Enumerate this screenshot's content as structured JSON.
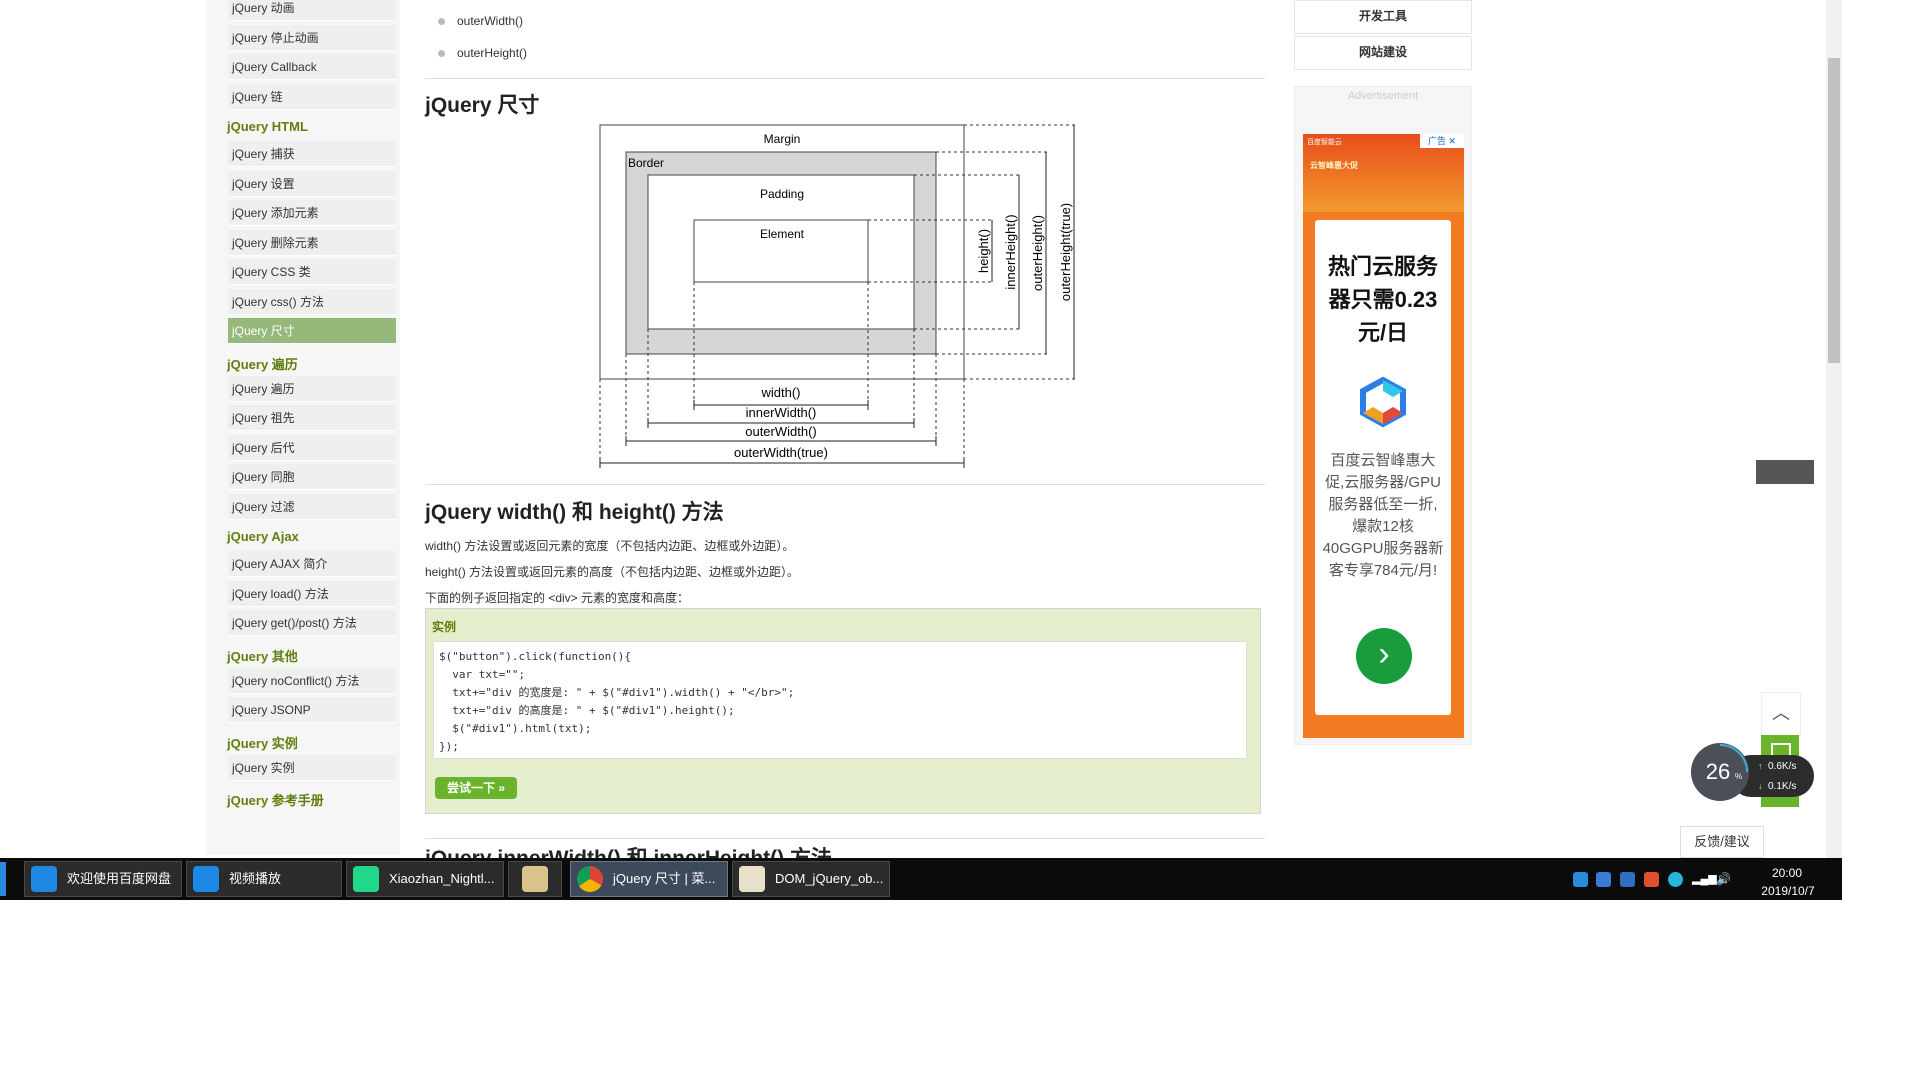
{
  "sidebar": {
    "items_top": [
      "jQuery 动画",
      "jQuery 停止动画",
      "jQuery Callback",
      "jQuery 链"
    ],
    "html_head": "jQuery HTML",
    "html_items": [
      "jQuery 捕获",
      "jQuery 设置",
      "jQuery 添加元素",
      "jQuery 删除元素",
      "jQuery CSS 类",
      "jQuery css() 方法",
      "jQuery 尺寸"
    ],
    "traverse_head": "jQuery 遍历",
    "traverse_items": [
      "jQuery 遍历",
      "jQuery 祖先",
      "jQuery 后代",
      "jQuery 同胞",
      "jQuery 过滤"
    ],
    "ajax_head": "jQuery Ajax",
    "ajax_items": [
      "jQuery AJAX 简介",
      "jQuery load() 方法",
      "jQuery get()/post() 方法"
    ],
    "other_head": "jQuery 其他",
    "other_items": [
      "jQuery noConflict() 方法",
      "jQuery JSONP"
    ],
    "example_head": "jQuery 实例",
    "example_items": [
      "jQuery 实例"
    ],
    "ref_head": "jQuery 参考手册"
  },
  "main": {
    "bullets": [
      "outerWidth()",
      "outerHeight()"
    ],
    "section1_title": "jQuery 尺寸",
    "diagram": {
      "margin": "Margin",
      "border": "Border",
      "padding": "Padding",
      "element": "Element",
      "width": "width()",
      "innerWidth": "innerWidth()",
      "outerWidth": "outerWidth()",
      "outerWidthTrue": "outerWidth(true)",
      "height": "height()",
      "innerHeight": "innerHeight()",
      "outerHeight": "outerHeight()",
      "outerHeightTrue": "outerHeight(true)"
    },
    "section2_title": "jQuery width() 和 height() 方法",
    "para1": "width() 方法设置或返回元素的宽度（不包括内边距、边框或外边距）。",
    "para2": "height() 方法设置或返回元素的高度（不包括内边距、边框或外边距）。",
    "para3": "下面的例子返回指定的 <div> 元素的宽度和高度：",
    "example_label": "实例",
    "code_lines": [
      "$(\"button\").click(function(){",
      "  var txt=\"\";",
      "  txt+=\"div 的宽度是: \" + $(\"#div1\").width() + \"</br>\";",
      "  txt+=\"div 的高度是: \" + $(\"#div1\").height();",
      "  $(\"#div1\").html(txt);",
      "});"
    ],
    "try_button": "尝试一下 »",
    "next_title_partial": "jQuery innerWidth() 和 innerHeight() 方法"
  },
  "right": {
    "btn1": "开发工具",
    "btn2": "网站建设",
    "ad_label": "Advertisement",
    "ad_badge": "广告",
    "ad_brand": "百度智能云",
    "ad_promo": "云智峰惠大促",
    "ad_title": "热门云服务器只需0.23元/日",
    "ad_body": "百度云智峰惠大促,云服务器/GPU服务器低至一折,爆款12核40GGPU服务器新客专享784元/月!"
  },
  "widgets": {
    "percent": "26",
    "percent_unit": "%",
    "up_speed": "0.6K/s",
    "down_speed": "0.1K/s",
    "feedback": "反馈/建议"
  },
  "taskbar": {
    "tasks": [
      "欢迎使用百度网盘",
      "视频播放",
      "Xiaozhan_Nightl...",
      "",
      "jQuery 尺寸 | 菜...",
      "DOM_jQuery_ob..."
    ],
    "time": "20:00",
    "date": "2019/10/7"
  }
}
